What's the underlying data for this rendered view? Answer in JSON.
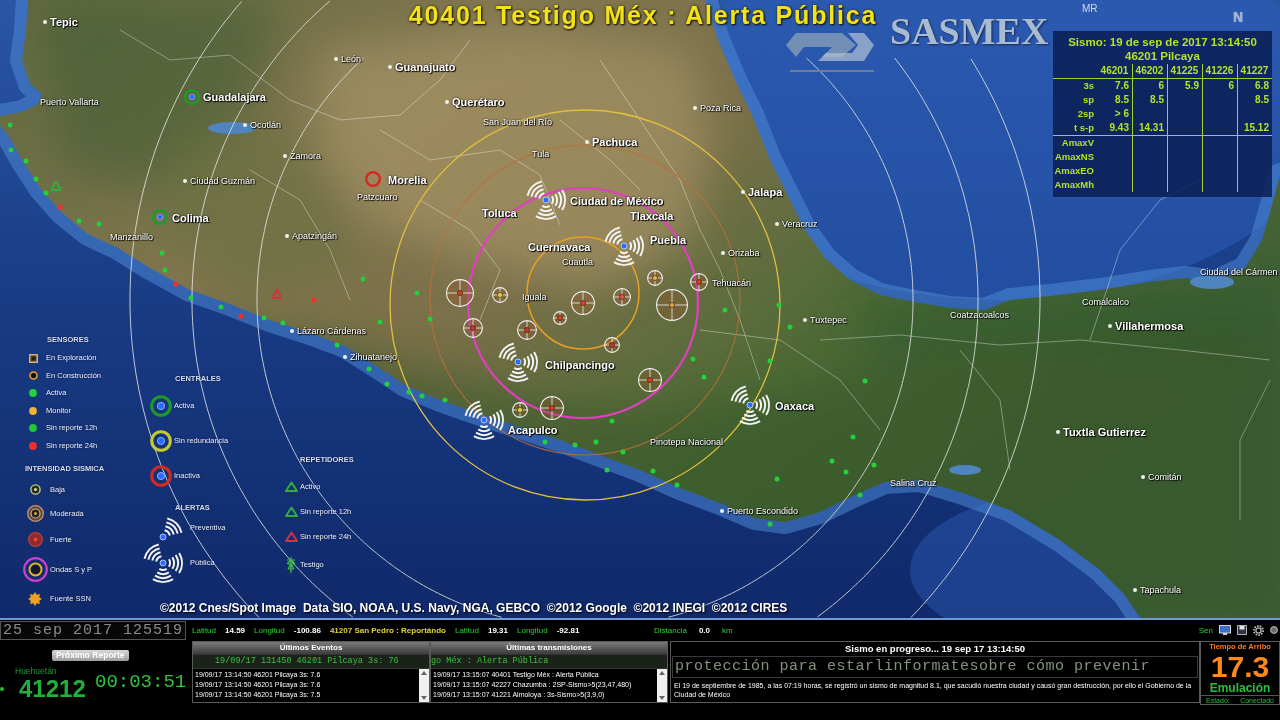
{
  "title": "40401 Testigo Méx : Alerta Pública",
  "brand": {
    "name": "SASMEX",
    "mark": "MR",
    "compass": "N"
  },
  "event_table": {
    "title": "Sismo: 19 de sep de 2017 13:14:50",
    "station": "46201 Pilcaya",
    "columns": [
      "46201",
      "46202",
      "41225",
      "41226",
      "41227"
    ],
    "rows": [
      {
        "label": "3s",
        "cells": [
          "7.6",
          "6",
          "5.9",
          "6",
          "6.8"
        ]
      },
      {
        "label": "sp",
        "cells": [
          "8.5",
          "8.5",
          null,
          null,
          "8.5"
        ]
      },
      {
        "label": "2sp",
        "cells": [
          "> 6",
          null,
          null,
          null,
          null
        ]
      },
      {
        "label": "t s-p",
        "cells": [
          "9.43",
          "14.31",
          null,
          null,
          "15.12"
        ]
      },
      {
        "label": "AmaxV",
        "cells": [
          null,
          null,
          null,
          null,
          null
        ]
      },
      {
        "label": "AmaxNS",
        "cells": [
          null,
          null,
          null,
          null,
          null
        ]
      },
      {
        "label": "AmaxEO",
        "cells": [
          null,
          null,
          null,
          null,
          null
        ]
      },
      {
        "label": "AmaxMh",
        "cells": [
          null,
          null,
          null,
          null,
          null
        ]
      }
    ]
  },
  "map": {
    "cities": [
      {
        "name": "Tepic",
        "kind": "major"
      },
      {
        "name": "Puerto Vallarta",
        "kind": "minor"
      },
      {
        "name": "León",
        "kind": "minor"
      },
      {
        "name": "Guanajuato",
        "kind": "major"
      },
      {
        "name": "Guadalajara",
        "kind": "major"
      },
      {
        "name": "Querétaro",
        "kind": "major"
      },
      {
        "name": "Ocotlán",
        "kind": "minor"
      },
      {
        "name": "San Juan del Río",
        "kind": "minor"
      },
      {
        "name": "Poza Rica",
        "kind": "minor"
      },
      {
        "name": "Pachuca",
        "kind": "major"
      },
      {
        "name": "Tula",
        "kind": "minor"
      },
      {
        "name": "Zamora",
        "kind": "minor"
      },
      {
        "name": "Ciudad Guzmán",
        "kind": "minor"
      },
      {
        "name": "Morelia",
        "kind": "major"
      },
      {
        "name": "Patzcuaro",
        "kind": "minor"
      },
      {
        "name": "Jalapa",
        "kind": "major"
      },
      {
        "name": "Veracruz",
        "kind": "minor"
      },
      {
        "name": "Ciudad de México",
        "kind": "major"
      },
      {
        "name": "Toluca",
        "kind": "major"
      },
      {
        "name": "Tlaxcala",
        "kind": "major"
      },
      {
        "name": "Puebla",
        "kind": "major"
      },
      {
        "name": "Cuernavaca",
        "kind": "major"
      },
      {
        "name": "Cuautla",
        "kind": "minor"
      },
      {
        "name": "Orizaba",
        "kind": "minor"
      },
      {
        "name": "Colima",
        "kind": "major"
      },
      {
        "name": "Manzanillo",
        "kind": "minor"
      },
      {
        "name": "Apatzingán",
        "kind": "minor"
      },
      {
        "name": "Iguala",
        "kind": "minor"
      },
      {
        "name": "Tehuacán",
        "kind": "minor"
      },
      {
        "name": "Tuxtepec",
        "kind": "minor"
      },
      {
        "name": "Coatzacoalcos",
        "kind": "minor"
      },
      {
        "name": "Comalcalco",
        "kind": "minor"
      },
      {
        "name": "Villahermosa",
        "kind": "major"
      },
      {
        "name": "Ciudad del Cármen",
        "kind": "minor"
      },
      {
        "name": "Lázaro Cárdenas",
        "kind": "minor"
      },
      {
        "name": "Zihuatanejo",
        "kind": "minor"
      },
      {
        "name": "Chilpancingo",
        "kind": "major"
      },
      {
        "name": "Acapulco",
        "kind": "major"
      },
      {
        "name": "Oaxaca",
        "kind": "major"
      },
      {
        "name": "Pinotepa Nacional",
        "kind": "minor"
      },
      {
        "name": "Puerto Escondido",
        "kind": "minor"
      },
      {
        "name": "Salina Cruz",
        "kind": "minor"
      },
      {
        "name": "Tuxtla Gutierrez",
        "kind": "major"
      },
      {
        "name": "Comitán",
        "kind": "minor"
      },
      {
        "name": "Tapachula",
        "kind": "minor"
      }
    ],
    "attribution": "©2012 Cnes/Spot Image  Data SIO, NOAA, U.S. Navy, NGA, GEBCO  ©2012 Google  ©2012 INEGI  ©2012 CIRES"
  },
  "legend": [
    {
      "title": "SENSORES",
      "items": [
        {
          "label": "En Exploración",
          "kind": "square"
        },
        {
          "label": "En Construcción",
          "kind": "ring"
        },
        {
          "label": "Activa",
          "kind": "dot",
          "color": "#22d03a"
        },
        {
          "label": "Monitor",
          "kind": "dot",
          "color": "#f2b233"
        },
        {
          "label": "Sin reporte 12h",
          "kind": "dot",
          "color": "#1fc836"
        },
        {
          "label": "Sin reporte 24h",
          "kind": "dot",
          "color": "#f0302a"
        }
      ]
    },
    {
      "title": "INTENSIDAD SISMICA",
      "items": [
        {
          "label": "Baja",
          "kind": "weak"
        },
        {
          "label": "Moderada",
          "kind": "moderate"
        },
        {
          "label": "Fuerte",
          "kind": "strong"
        },
        {
          "label": "Ondas S y P",
          "kind": "waves"
        },
        {
          "label": "Fuente SSN",
          "kind": "source"
        }
      ]
    },
    {
      "title": "CENTRALES",
      "items": [
        {
          "label": "Activa",
          "kind": "central",
          "color": "#1f9a2a"
        },
        {
          "label": "Sin redundancia",
          "kind": "central",
          "color": "#c8c830"
        },
        {
          "label": "Inactiva",
          "kind": "central",
          "color": "#d42a20"
        }
      ]
    },
    {
      "title": "ALERTAS",
      "items": [
        {
          "label": "Preventiva",
          "kind": "preventive"
        },
        {
          "label": "Pública",
          "kind": "public"
        }
      ]
    },
    {
      "title": "REPETIDORES",
      "items": [
        {
          "label": "Activo",
          "kind": "triangle",
          "color": "#2fae3a"
        },
        {
          "label": "Sin reporte 12h",
          "kind": "triangle",
          "color": "#2fae3a"
        },
        {
          "label": "Sin reporte 24h",
          "kind": "triangle",
          "color": "#d0343a"
        },
        {
          "label": "Testigo",
          "kind": "antenna"
        }
      ]
    }
  ],
  "clock": "25 sep 2017 125519",
  "position_bar": {
    "items": [
      {
        "kind": "label",
        "text": "Latitud"
      },
      {
        "kind": "value",
        "text": "14.59"
      },
      {
        "kind": "label",
        "text": "Longitud"
      },
      {
        "kind": "value",
        "text": "-100.86"
      },
      {
        "kind": "message",
        "text": "41207 San Pedro : Reportándo"
      },
      {
        "kind": "label",
        "text": "Latitud"
      },
      {
        "kind": "value",
        "text": "19.31"
      },
      {
        "kind": "label",
        "text": "Longitud"
      },
      {
        "kind": "value",
        "text": "-92.81"
      }
    ],
    "distance": {
      "label": "Distancia",
      "value": "0.0",
      "unit": "km"
    },
    "mode": "Sen"
  },
  "next_report": {
    "badge": "Próximo Reporte",
    "station": "Huehuetán",
    "code": "41212",
    "countdown": "00:03:51"
  },
  "logs": [
    {
      "title": "Últimos Eventos",
      "current": "19/09/17 131450 46201 Pilcaya 3s: 76",
      "entries": [
        "19/09/17 13:14:50 46201 Pilcaya 3s: 7.6",
        "19/09/17 13:14:50 46201 Pilcaya 3s: 7.6",
        "19/09/17 13:14:50 46201 Pilcaya 3s: 7.5"
      ]
    },
    {
      "title": "Últimas transmisiones",
      "current": "go Méx : Alerta Pública",
      "entries": [
        "19/09/17 13:15:07 40401 Testigo Méx : Alerta Pública",
        "19/09/17 13:15:07 42227 Chazumba : 2SP-Sismo>5(23,47,480)",
        "19/09/17 13:15:07 41221 Almoloya : 3s-Sismo>5(3,9,0)"
      ]
    }
  ],
  "progress": {
    "title": "Sismo en progreso... 19 sep 17 13:14:50",
    "marquee": "protección para estarlinformatesobre cómo prevenir",
    "news": "El 19 de septiembre de 1985, a las 07:19 horas, se registró un sismo de magnitud 8.1, que sacudió nuestra ciudad y causó gran destrucción, por ello el Gobierno de la Ciudad de México"
  },
  "arrival": {
    "title": "Tiempo de Arribo",
    "value": "17.3",
    "mode": "Emulación",
    "status_label": "Estado:",
    "status": "Conectado"
  }
}
